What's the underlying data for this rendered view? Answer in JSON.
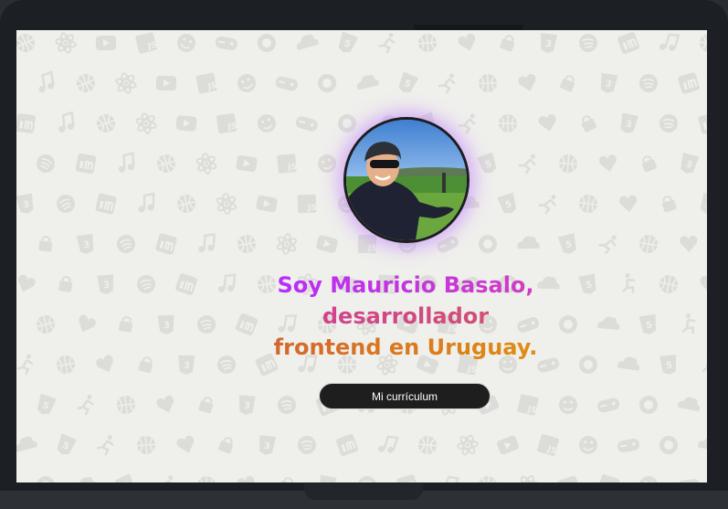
{
  "hero": {
    "headline_line1": "Soy Mauricio Basalo,",
    "headline_line2": "desarrollador",
    "headline_line3": "frontend en Uruguay.",
    "cv_button_label": "Mi currículum"
  },
  "background_pattern_icons": [
    "globe-icon",
    "gamepad-icon",
    "basketball-icon",
    "linkedin-icon",
    "javascript-icon",
    "html5-icon",
    "css3-icon",
    "react-icon",
    "github-icon",
    "heart-icon",
    "music-note-icon",
    "smiley-icon",
    "running-person-icon",
    "spotify-icon",
    "youtube-icon",
    "cloud-icon",
    "lock-icon"
  ],
  "colors": {
    "screen_background": "#efefec",
    "pattern_icon": "#dcdcd8",
    "gradient_start": "#b62bff",
    "gradient_end": "#e0900f",
    "button_background": "#1e1e1e",
    "avatar_glow": "#be78ff",
    "device_frame": "#1c2024"
  }
}
